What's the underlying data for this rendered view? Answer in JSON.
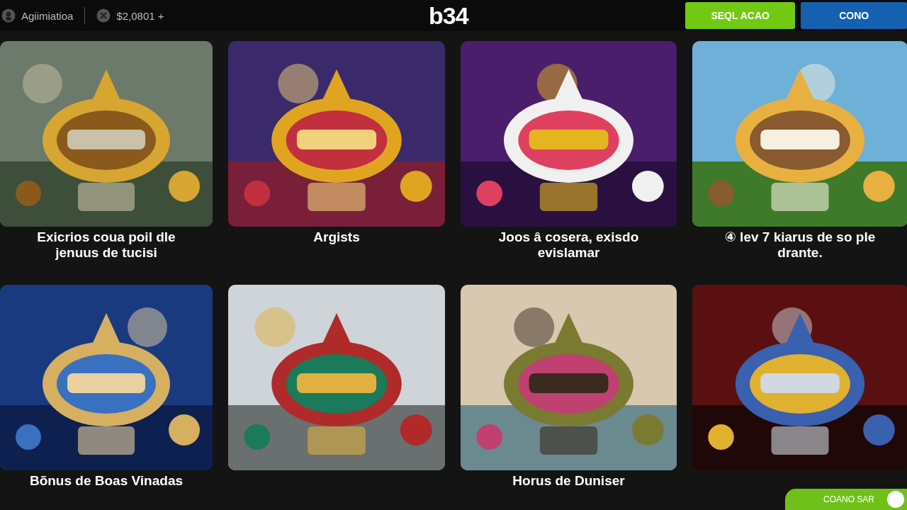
{
  "header": {
    "account": "Agiimiatioa",
    "balance": "$2,0801 +",
    "logo": "b34",
    "buttons": [
      {
        "label": "SEQL ACAO",
        "kind": "primary"
      },
      {
        "label": "CONO",
        "kind": "secondary"
      }
    ]
  },
  "cards": [
    {
      "kind": "picture",
      "caption": "Exicrios coua poil dle jenuus de tucisi"
    },
    {
      "kind": "picture",
      "caption": "Argists"
    },
    {
      "kind": "picture",
      "caption": "Joos â cosera, exisdo evislamar"
    },
    {
      "kind": "picture",
      "caption": "④ lev 7 kiarus de so ple drante."
    },
    {
      "kind": "picture",
      "caption": "Bõnus de Boas Vinadas"
    },
    {
      "kind": "picture"
    },
    {
      "kind": "picture",
      "caption": "Horus de Duniser"
    },
    {
      "kind": "picture"
    }
  ],
  "toggle": {
    "label": "COANO SAR",
    "on": true
  }
}
